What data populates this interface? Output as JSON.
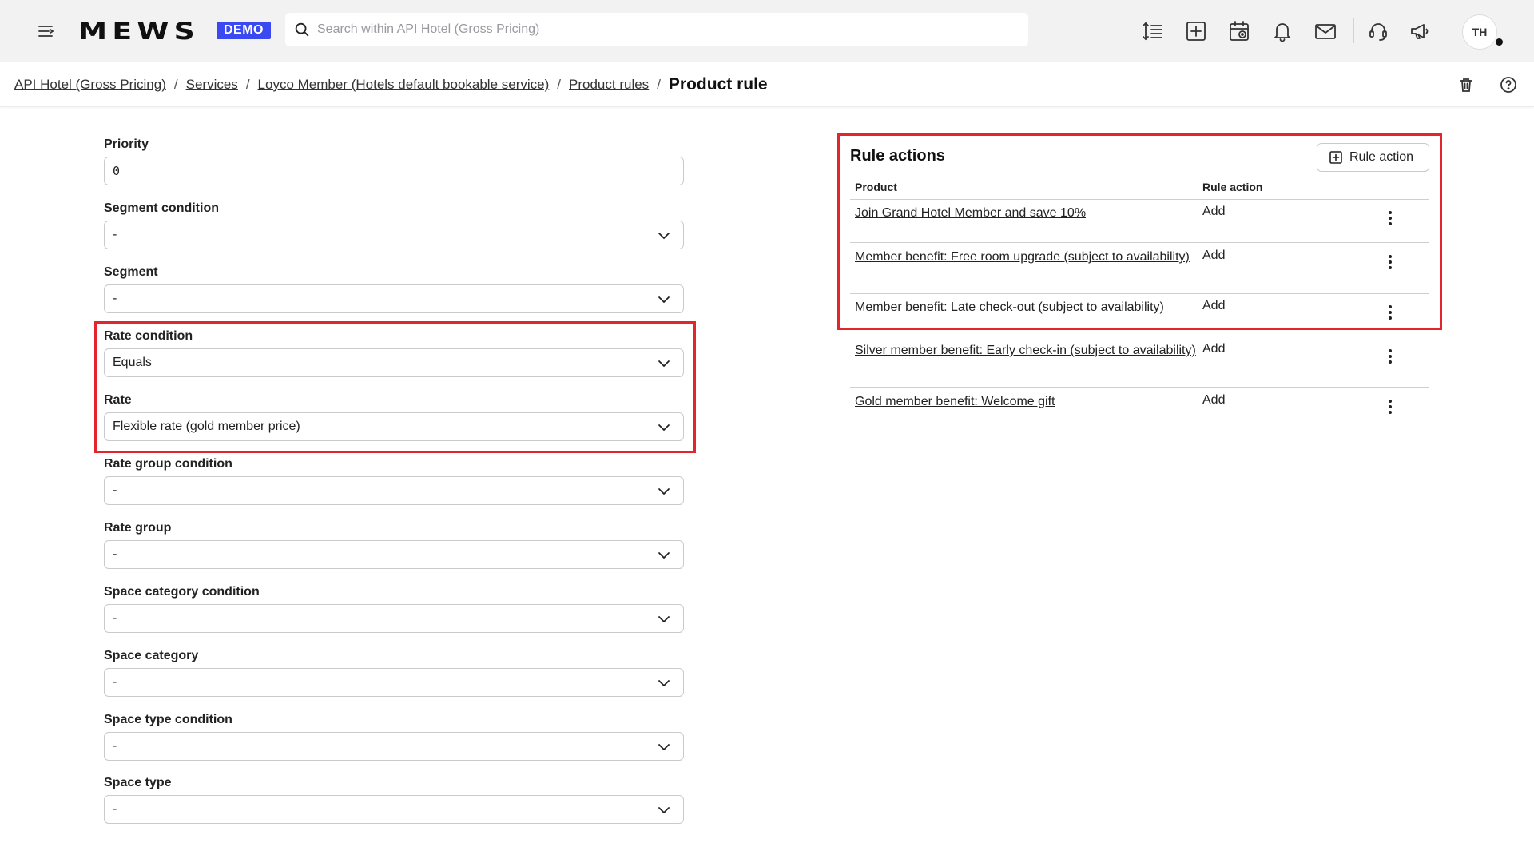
{
  "header": {
    "logo": "MEWS",
    "badge": "DEMO",
    "search_placeholder": "Search within API Hotel (Gross Pricing)",
    "avatar_initials": "TH"
  },
  "breadcrumb": {
    "items": [
      "API Hotel (Gross Pricing)",
      "Services",
      "Loyco Member (Hotels default bookable service)",
      "Product rules"
    ],
    "separator": "/",
    "current": "Product rule"
  },
  "form": {
    "priority": {
      "label": "Priority",
      "value": "0"
    },
    "segment_condition": {
      "label": "Segment condition",
      "value": "-"
    },
    "segment": {
      "label": "Segment",
      "value": "-"
    },
    "rate_condition": {
      "label": "Rate condition",
      "value": "Equals"
    },
    "rate": {
      "label": "Rate",
      "value": "Flexible rate (gold member price)"
    },
    "rate_group_condition": {
      "label": "Rate group condition",
      "value": "-"
    },
    "rate_group": {
      "label": "Rate group",
      "value": "-"
    },
    "space_category_condition": {
      "label": "Space category condition",
      "value": "-"
    },
    "space_category": {
      "label": "Space category",
      "value": "-"
    },
    "space_type_condition": {
      "label": "Space type condition",
      "value": "-"
    },
    "space_type": {
      "label": "Space type",
      "value": "-"
    }
  },
  "rule_actions": {
    "title": "Rule actions",
    "add_button": "Rule action",
    "columns": [
      "Product",
      "Rule action"
    ],
    "rows": [
      {
        "product": "Join Grand Hotel Member and save 10%",
        "action": "Add"
      },
      {
        "product": "Member benefit: Free room upgrade (subject to availability)",
        "action": "Add"
      },
      {
        "product": "Member benefit: Late check-out (subject to availability)",
        "action": "Add"
      },
      {
        "product": "Silver member benefit: Early check-in (subject to availability)",
        "action": "Add"
      },
      {
        "product": "Gold member benefit: Welcome gift",
        "action": "Add"
      }
    ]
  },
  "colors": {
    "highlight": "#e3262e",
    "demo_badge": "#3a49f0",
    "topbar_bg": "#f2f2f3"
  }
}
